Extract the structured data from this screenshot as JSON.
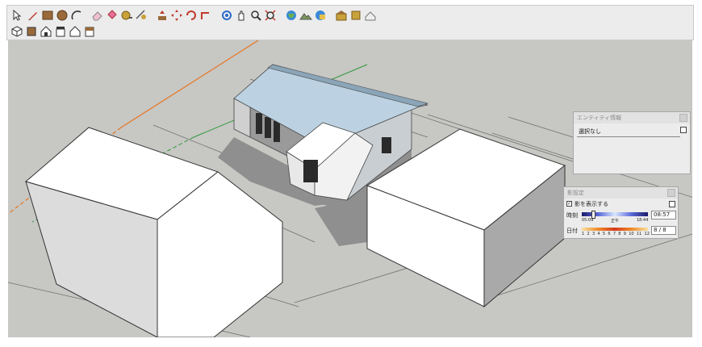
{
  "toolbar": {
    "row1": [
      "select-icon",
      "pencil-icon",
      "rectangle-icon",
      "circle-icon",
      "arc-icon",
      "eraser-icon",
      "paint-bucket-icon",
      "tape-measure-icon",
      "dimension-icon",
      "push-pull-icon",
      "move-icon",
      "rotate-icon",
      "follow-me-icon",
      "orbit-icon",
      "pan-icon",
      "zoom-icon",
      "zoom-extents-icon",
      "add-location-icon",
      "terrain-icon",
      "photo-textures-icon",
      "warehouse-icon",
      "extension-icon",
      "model-info-icon"
    ],
    "row2": [
      "iso-view-icon",
      "top-view-icon",
      "front-view-icon",
      "right-view-icon",
      "back-view-icon",
      "left-view-icon"
    ]
  },
  "entity_panel": {
    "title": "エンティティ情報",
    "selection": "選択なし"
  },
  "shadow_panel": {
    "title": "影設定",
    "show_shadows_label": "影を表示する",
    "show_shadows_checked": true,
    "time_label": "時刻",
    "time_start": "05:09",
    "time_mid": "正午",
    "time_end": "18:44",
    "time_value": "08:57",
    "date_label": "日付",
    "months": [
      "1",
      "2",
      "3",
      "4",
      "5",
      "6",
      "7",
      "8",
      "9",
      "10",
      "11",
      "12"
    ],
    "date_value": "8 / 8"
  },
  "colors": {
    "sky": "#c7c7c4",
    "roof": "#bcd2e2",
    "axis_red": "#e8751f",
    "axis_green": "#2f9a3a"
  }
}
